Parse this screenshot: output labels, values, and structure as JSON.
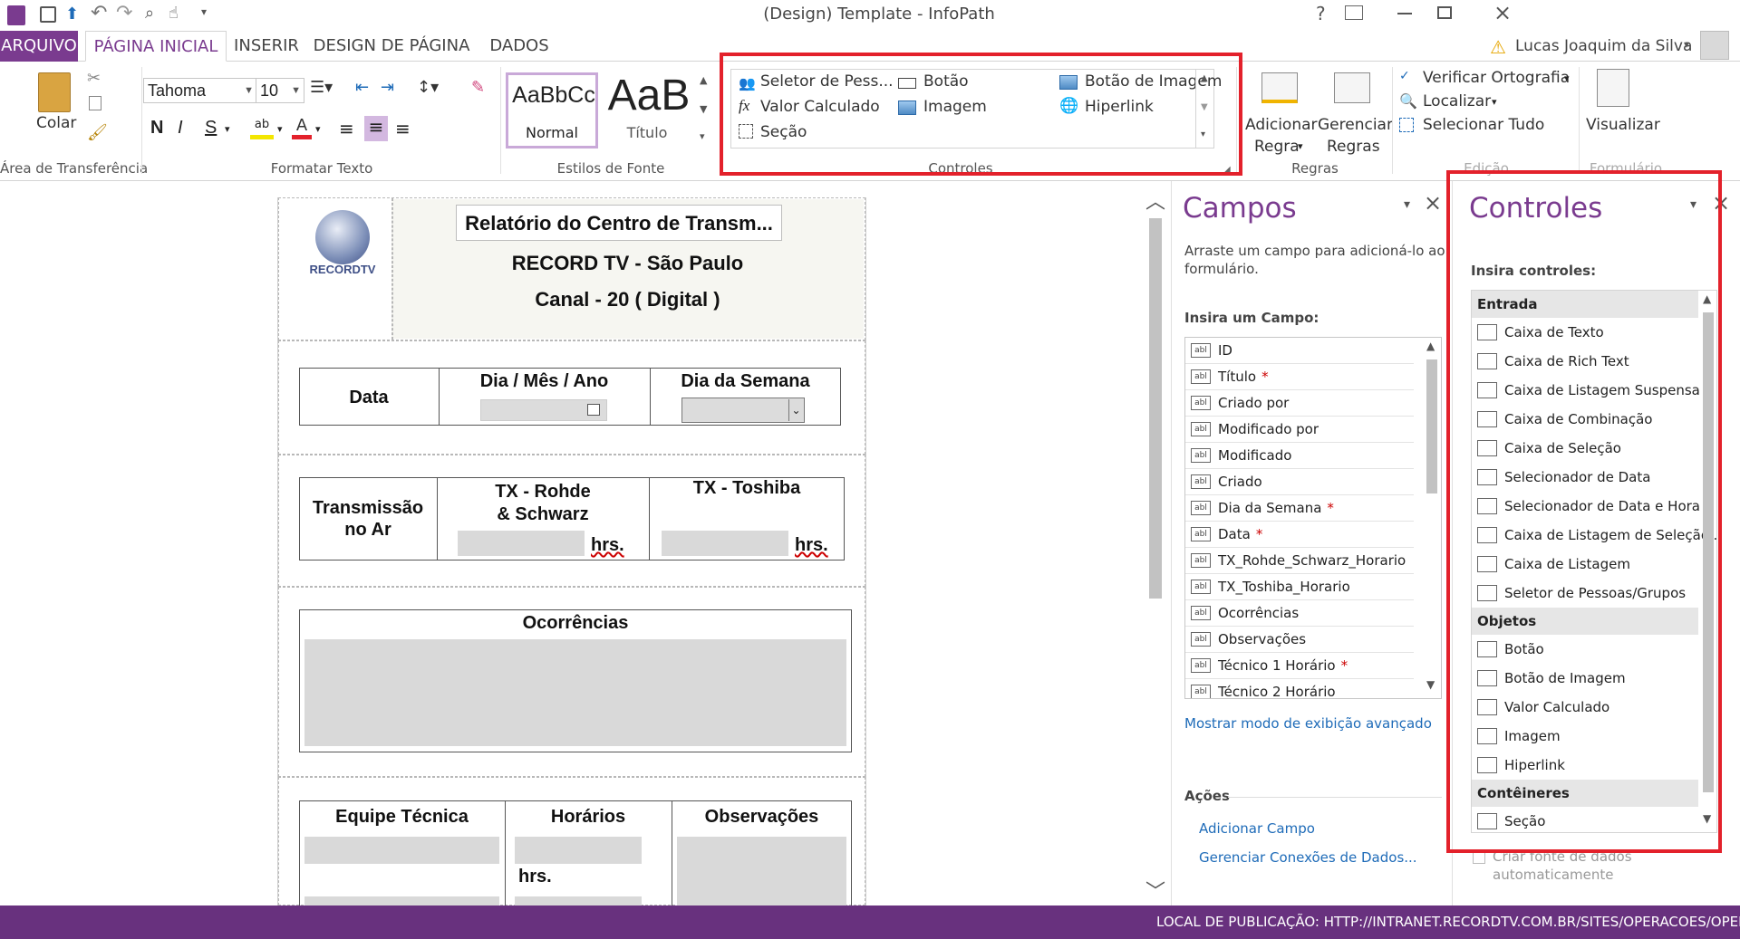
{
  "window": {
    "title": "(Design) Template - InfoPath",
    "help": "?",
    "user": "Lucas Joaquim da Silva"
  },
  "tabs": [
    {
      "label": "ARQUIVO"
    },
    {
      "label": "PÁGINA INICIAL"
    },
    {
      "label": "INSERIR"
    },
    {
      "label": "DESIGN DE PÁGINA"
    },
    {
      "label": "DADOS"
    }
  ],
  "ribbon": {
    "clipboard": {
      "paste": "Colar",
      "group": "Área de Transferência"
    },
    "format_text": {
      "font": "Tahoma",
      "size": "10",
      "bold": "N",
      "italic": "I",
      "underline": "S",
      "group": "Formatar Texto"
    },
    "styles": {
      "normal_preview": "AaBbCc",
      "normal": "Normal",
      "title_preview": "AaB",
      "title": "Título",
      "group": "Estilos de Fonte"
    },
    "controls": {
      "people_picker": "Seletor de Pess...",
      "button": "Botão",
      "image_button": "Botão de Imagem",
      "calc_value": "Valor Calculado",
      "image": "Imagem",
      "hyperlink": "Hiperlink",
      "section": "Seção",
      "group": "Controles"
    },
    "rules": {
      "add_rule_1": "Adicionar",
      "add_rule_2": "Regra",
      "manage_1": "Gerenciar",
      "manage_2": "Regras",
      "group": "Regras"
    },
    "editing": {
      "spell": "Verificar Ortografia",
      "find": "Localizar",
      "select_all": "Selecionar Tudo",
      "group": "Edição"
    },
    "form": {
      "preview": "Visualizar",
      "group": "Formulário"
    }
  },
  "form": {
    "logo_text": "RECORDTV",
    "title": "Relatório do Centro de Transm...",
    "subtitle": "RECORD TV - São Paulo",
    "channel": "Canal - 20 ( Digital )",
    "data_label": "Data",
    "date_header": "Dia / Mês / Ano",
    "weekday_header": "Dia da Semana",
    "transmission_1": "Transmissão",
    "transmission_2": "no Ar",
    "tx_rohde_1": "TX - Rohde",
    "tx_rohde_2": "& Schwarz",
    "tx_toshiba": "TX - Toshiba",
    "hrs": "hrs.",
    "occurrences": "Ocorrências",
    "team": "Equipe Técnica",
    "hours": "Horários",
    "observations": "Observações"
  },
  "fields_pane": {
    "title": "Campos",
    "desc_1": "Arraste um campo para adicioná-lo ao",
    "desc_2": "formulário.",
    "insert_label": "Insira um Campo:",
    "items": [
      {
        "label": "ID",
        "req": ""
      },
      {
        "label": "Título",
        "req": "*"
      },
      {
        "label": "Criado por",
        "req": ""
      },
      {
        "label": "Modificado por",
        "req": ""
      },
      {
        "label": "Modificado",
        "req": ""
      },
      {
        "label": "Criado",
        "req": ""
      },
      {
        "label": "Dia da Semana",
        "req": "*"
      },
      {
        "label": "Data",
        "req": "*"
      },
      {
        "label": "TX_Rohde_Schwarz_Horario",
        "req": ""
      },
      {
        "label": "TX_Toshiba_Horario",
        "req": ""
      },
      {
        "label": "Ocorrências",
        "req": ""
      },
      {
        "label": "Observações",
        "req": ""
      },
      {
        "label": "Técnico 1 Horário",
        "req": "*"
      },
      {
        "label": "Técnico 2 Horário",
        "req": ""
      }
    ],
    "advanced_link": "Mostrar modo de exibição avançado",
    "actions_label": "Ações",
    "add_field": "Adicionar Campo",
    "manage_connections": "Gerenciar Conexões de Dados..."
  },
  "controls_pane": {
    "title": "Controles",
    "insert_label": "Insira controles:",
    "input_head": "Entrada",
    "input_items": [
      "Caixa de Texto",
      "Caixa de Rich Text",
      "Caixa de Listagem Suspensa",
      "Caixa de Combinação",
      "Caixa de Seleção",
      "Selecionador de Data",
      "Selecionador de Data e Hora",
      "Caixa de Listagem de Seleção...",
      "Caixa de Listagem",
      "Seletor de Pessoas/Grupos"
    ],
    "objects_head": "Objetos",
    "object_items": [
      "Botão",
      "Botão de Imagem",
      "Valor Calculado",
      "Imagem",
      "Hiperlink"
    ],
    "containers_head": "Contêineres",
    "container_items": [
      "Seção"
    ],
    "auto_ds_1": "Criar fonte de dados",
    "auto_ds_2": "automaticamente"
  },
  "status": {
    "text": "LOCAL DE PUBLICAÇÃO: HTTP://INTRANET.RECORDTV.COM.BR/SITES/OPERACOES/OPER..."
  },
  "colors": {
    "accent": "#7a3b8f",
    "status_bar": "#68317e",
    "highlight_box": "#e3212b"
  }
}
